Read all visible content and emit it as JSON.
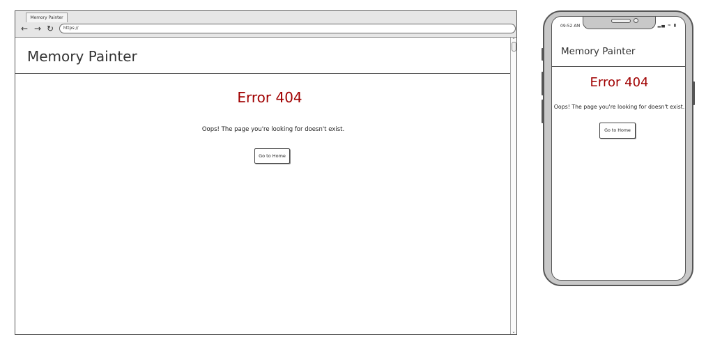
{
  "browser": {
    "tab_title": "Memory Painter",
    "url": "https://",
    "icons": {
      "back": "arrow-left-icon",
      "forward": "arrow-right-icon",
      "reload": "reload-icon"
    }
  },
  "site": {
    "brand": "Memory Painter",
    "error_title": "Error 404",
    "error_message": "Oops! The page you're looking for doesn't exist.",
    "home_button_label": "Go to Home"
  },
  "mobile": {
    "status_time": "09:52 AM"
  },
  "colors": {
    "error_red": "#a00000",
    "frame_gray": "#c8c8c8",
    "border": "#555555"
  }
}
